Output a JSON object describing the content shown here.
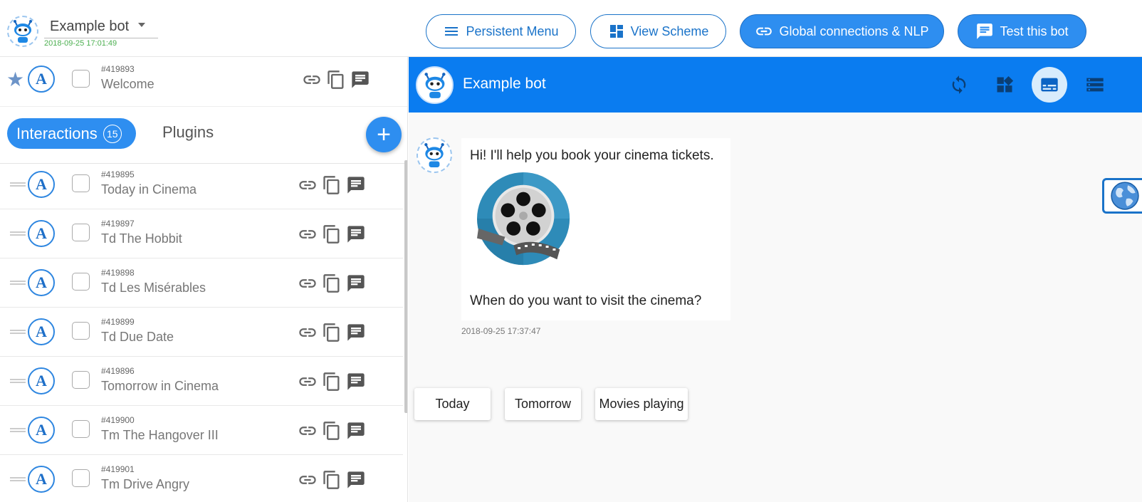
{
  "topbar": {
    "bot_name": "Example bot",
    "bot_date": "2018-09-25 17:01:49",
    "buttons": {
      "persistent_menu": "Persistent Menu",
      "view_scheme": "View Scheme",
      "global_connections": "Global connections & NLP",
      "test_bot": "Test this bot"
    }
  },
  "welcome": {
    "id": "#419893",
    "name": "Welcome"
  },
  "tabs": {
    "interactions": "Interactions",
    "interactions_count": "15",
    "plugins": "Plugins",
    "add": "+"
  },
  "interactions": [
    {
      "id": "#419895",
      "name": "Today in Cinema"
    },
    {
      "id": "#419897",
      "name": "Td The Hobbit"
    },
    {
      "id": "#419898",
      "name": "Td Les Misérables"
    },
    {
      "id": "#419899",
      "name": "Td Due Date"
    },
    {
      "id": "#419896",
      "name": "Tomorrow in Cinema"
    },
    {
      "id": "#419900",
      "name": "Tm The Hangover III"
    },
    {
      "id": "#419901",
      "name": "Tm Drive Angry"
    }
  ],
  "chat": {
    "title": "Example bot",
    "message_1": "Hi! I'll help you book your cinema tickets.",
    "message_2": "When do you want to visit the cinema?",
    "timestamp": "2018-09-25 17:37:47",
    "quick_replies": [
      "Today",
      "Tomorrow",
      "Movies playing"
    ]
  },
  "colors": {
    "accent": "#2e8ef0",
    "header": "#0a7cf0",
    "date_green": "#4caf50"
  },
  "icons": [
    "robot-icon",
    "menu-icon",
    "grid-icon",
    "link-icon",
    "chat-icon",
    "star-icon",
    "copy-icon",
    "refresh-icon",
    "widgets-icon",
    "subtitles-icon",
    "storage-icon",
    "globe-icon",
    "film-reel-icon"
  ]
}
